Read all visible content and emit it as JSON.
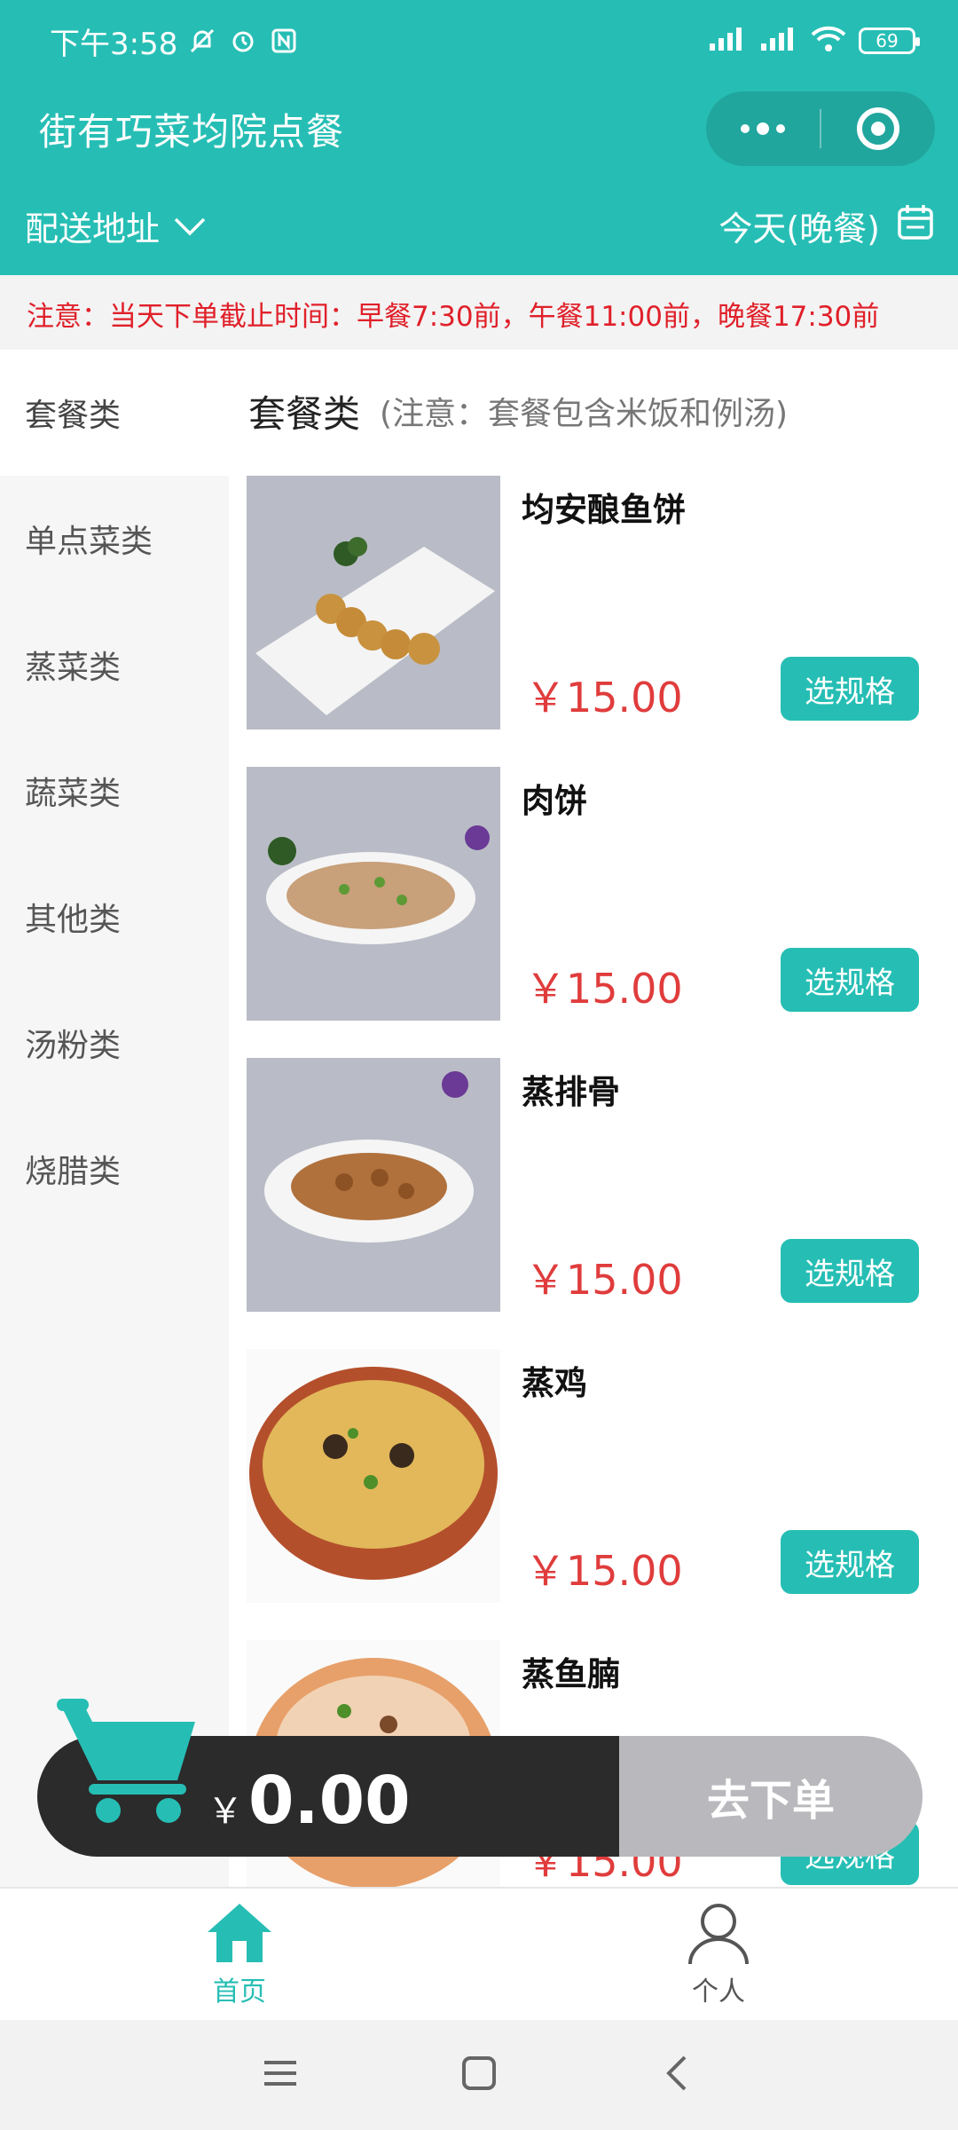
{
  "status_bar": {
    "time": "下午3:58",
    "battery": "69"
  },
  "title_bar": {
    "title": "街有巧菜均院点餐"
  },
  "address_row": {
    "address_label": "配送地址",
    "meal_time": "今天(晚餐)"
  },
  "notice": "注意：当天下单截止时间：早餐7:30前，午餐11:00前，晚餐17:30前",
  "sidebar": {
    "items": [
      {
        "label": "套餐类"
      },
      {
        "label": "单点菜类"
      },
      {
        "label": "蒸菜类"
      },
      {
        "label": "蔬菜类"
      },
      {
        "label": "其他类"
      },
      {
        "label": "汤粉类"
      },
      {
        "label": "烧腊类"
      }
    ]
  },
  "category": {
    "title": "套餐类",
    "note": "(注意：套餐包含米饭和例汤)"
  },
  "dishes": [
    {
      "name": "均安酿鱼饼",
      "price": "￥15.00",
      "button": "选规格"
    },
    {
      "name": "肉饼",
      "price": "￥15.00",
      "button": "选规格"
    },
    {
      "name": "蒸排骨",
      "price": "￥15.00",
      "button": "选规格"
    },
    {
      "name": "蒸鸡",
      "price": "￥15.00",
      "button": "选规格"
    },
    {
      "name": "蒸鱼腩",
      "price": "￥15.00",
      "button": "选规格"
    }
  ],
  "cart": {
    "currency": "￥",
    "total": "0.00",
    "checkout_label": "去下单"
  },
  "tabbar": {
    "home": "首页",
    "profile": "个人"
  },
  "colors": {
    "accent": "#26beb4",
    "price": "#e03c3c",
    "notice": "#e0202a"
  }
}
